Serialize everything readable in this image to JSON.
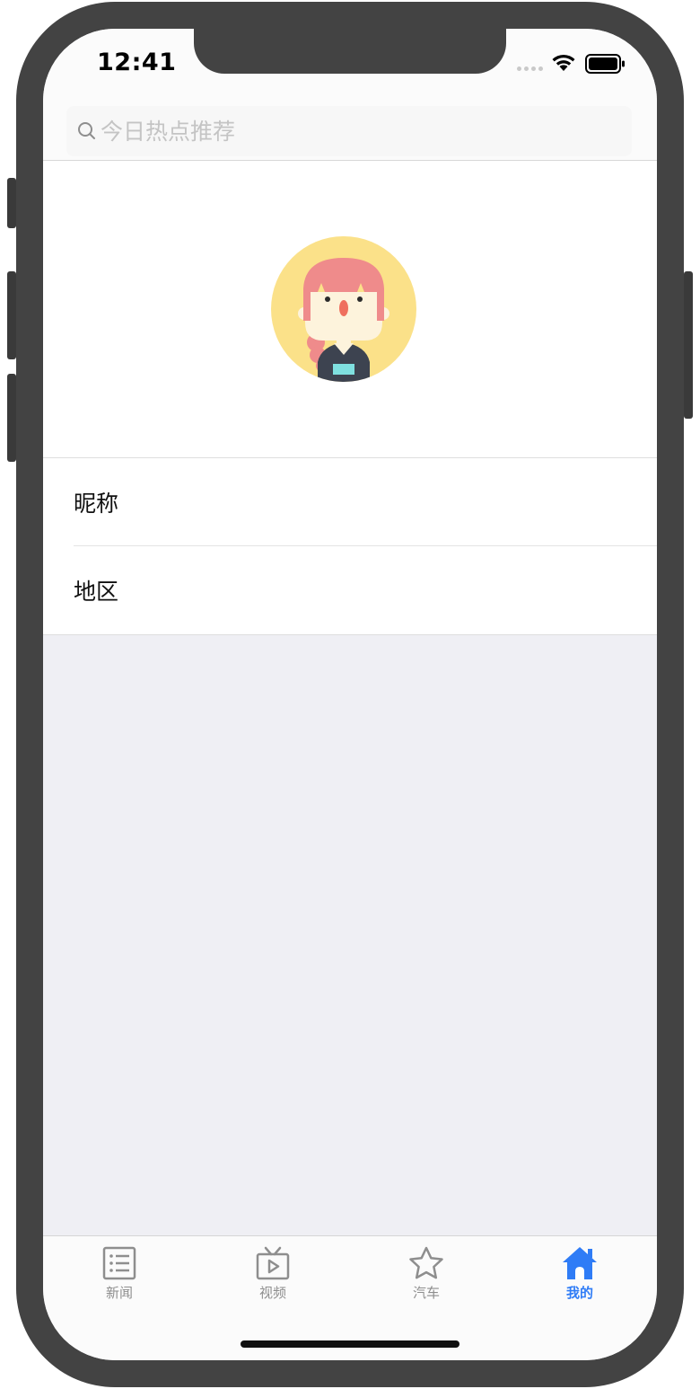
{
  "status_bar": {
    "time": "12:41"
  },
  "search": {
    "placeholder": "今日热点推荐"
  },
  "profile": {
    "avatar_icon": "girl-avatar-icon"
  },
  "list": {
    "items": [
      {
        "label": "昵称"
      },
      {
        "label": "地区"
      }
    ]
  },
  "tabbar": {
    "tabs": [
      {
        "label": "新闻",
        "icon": "list-icon"
      },
      {
        "label": "视频",
        "icon": "tv-play-icon"
      },
      {
        "label": "汽车",
        "icon": "star-icon"
      },
      {
        "label": "我的",
        "icon": "home-icon",
        "active": true
      }
    ]
  },
  "colors": {
    "accent": "#2f7cf6",
    "inactive": "#8e8e8e",
    "background": "#efeff4",
    "frame": "#434343"
  }
}
